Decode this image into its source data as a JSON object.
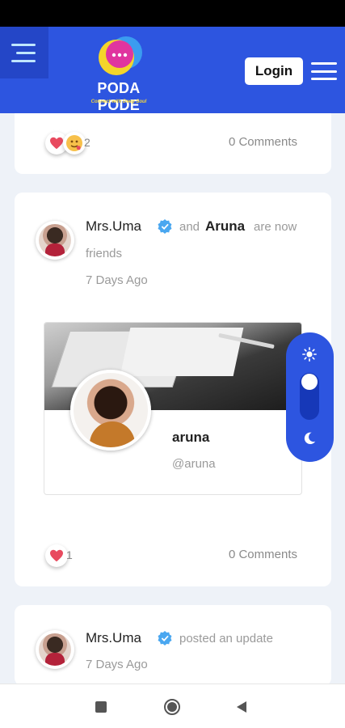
{
  "header": {
    "logo_title": "PODA PODE",
    "logo_tagline": "Connect with Deep Soul",
    "login_label": "Login",
    "colors": {
      "primary": "#2d55e0",
      "white": "#ffffff"
    }
  },
  "feed": {
    "top_card": {
      "reaction_count": "2",
      "comments": "0 Comments"
    },
    "friend_post": {
      "author": "Mrs.Uma",
      "connector": "and",
      "friend": "Aruna",
      "action": "are now",
      "action_cont": "friends",
      "time": "7 Days Ago",
      "profile": {
        "name": "aruna",
        "handle": "@aruna"
      },
      "reaction_count": "1",
      "comments": "0 Comments"
    },
    "update_post": {
      "author": "Mrs.Uma",
      "action": "posted an update",
      "time": "7 Days Ago"
    }
  },
  "icons": {
    "menu": "menu-toggle-icon",
    "hamburger": "hamburger-icon",
    "heart": "heart-icon",
    "emoji": "emoji-icon",
    "verified": "verified-icon",
    "sun": "sun-icon",
    "moon": "moon-icon",
    "nav_square": "recent-apps-icon",
    "nav_circle": "home-icon",
    "nav_back": "back-icon"
  }
}
